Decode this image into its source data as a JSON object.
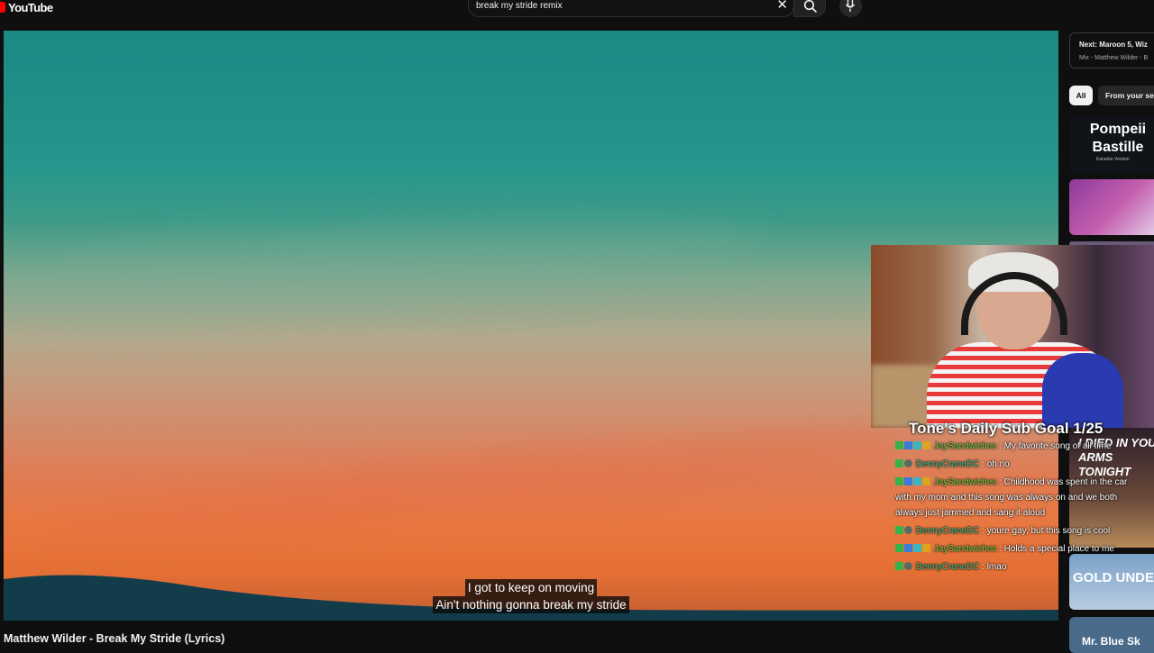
{
  "header": {
    "logo_text": "YouTube",
    "search_value": "break my stride remix",
    "clear_glyph": "✕"
  },
  "player": {
    "captions": [
      "I got to keep on moving",
      "Ain't nothing gonna break my stride"
    ],
    "title": "Matthew Wilder - Break My Stride (Lyrics)"
  },
  "sidebar": {
    "next_title": "Next: Maroon 5, Wiz",
    "next_sub": "Mix - Matthew Wilder - B",
    "chips": [
      "All",
      "From your se"
    ],
    "thumbs": [
      {
        "title": "Pompeii Bastille",
        "sub": "Karaoke Version"
      },
      {
        "title": ""
      },
      {
        "title": ""
      },
      {
        "title": "I DIED IN YOUR ARMS TONIGHT"
      },
      {
        "title": "GOLD UNDER"
      },
      {
        "title": "Mr. Blue Sk"
      }
    ]
  },
  "overlay": {
    "goal": "Tone's Daily Sub Goal 1/25",
    "chat": [
      {
        "user": "JaySandwiches",
        "text": ": My favorite song of all time",
        "badges": [
          "green",
          "blue",
          "cyan",
          "gold"
        ]
      },
      {
        "user": "DennyCraneDC",
        "text": ": oh no",
        "badges": [
          "green",
          "gray"
        ]
      },
      {
        "user": "JaySandwiches",
        "text": ": Childhood was spent in the car with my mom and this song was always on and we both always just jammed and sang it aloud",
        "badges": [
          "green",
          "blue",
          "cyan",
          "gold"
        ]
      },
      {
        "user": "DennyCraneDC",
        "text": ": youre gay, but this song is cool",
        "badges": [
          "green",
          "gray"
        ]
      },
      {
        "user": "JaySandwiches",
        "text": ": Holds a special place to me",
        "badges": [
          "green",
          "blue",
          "cyan",
          "gold"
        ]
      },
      {
        "user": "DennyCraneDC",
        "text": ": lmao",
        "badges": [
          "green",
          "gray"
        ]
      }
    ]
  },
  "colors": {
    "brand_red": "#ff0000",
    "user_jay": "#6ed34a",
    "user_denny": "#35c08a"
  }
}
